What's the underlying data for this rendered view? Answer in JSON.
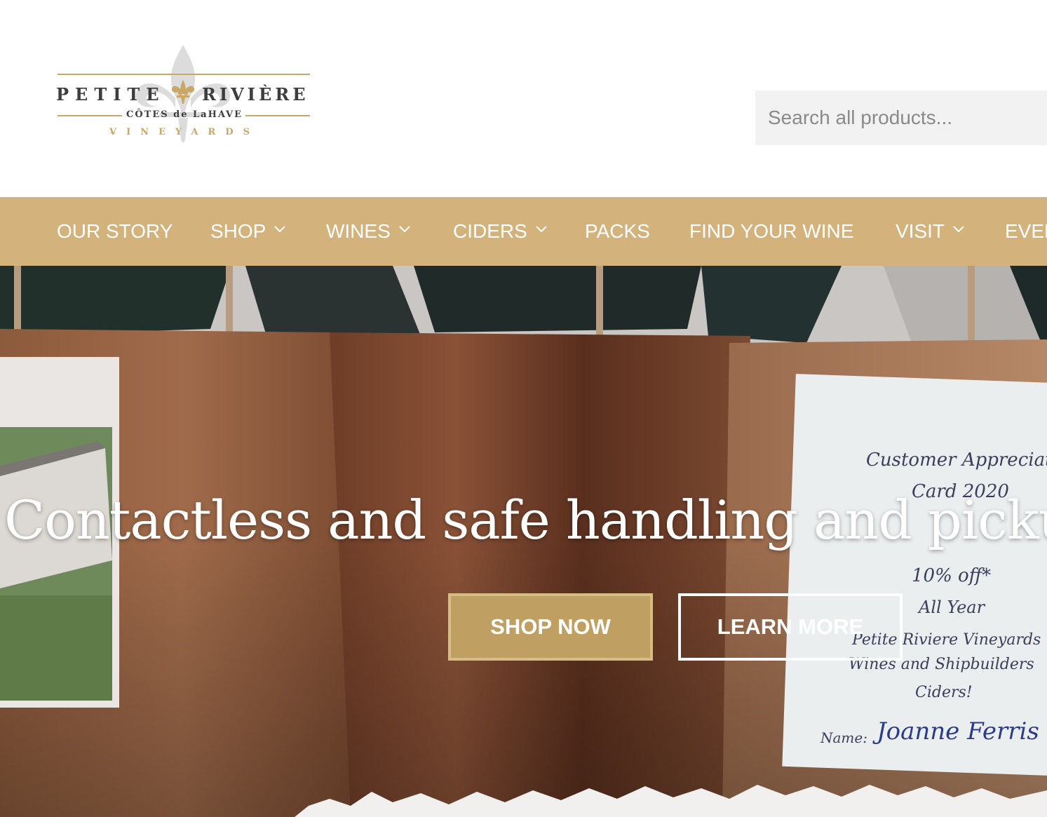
{
  "header": {
    "logo": {
      "name_left": "PETITE",
      "name_right": "RIVIÈRE",
      "subtitle": "CÔTES de LaHAVE",
      "tagline": "VINEYARDS"
    },
    "search": {
      "placeholder": "Search all products..."
    }
  },
  "nav": {
    "items": [
      {
        "label": "OUR STORY",
        "has_dropdown": false
      },
      {
        "label": "SHOP",
        "has_dropdown": true
      },
      {
        "label": "WINES",
        "has_dropdown": true
      },
      {
        "label": "CIDERS",
        "has_dropdown": true
      },
      {
        "label": "PACKS",
        "has_dropdown": false
      },
      {
        "label": "FIND YOUR WINE",
        "has_dropdown": false
      },
      {
        "label": "VISIT",
        "has_dropdown": true
      },
      {
        "label": "EVENTS",
        "has_dropdown": false
      }
    ]
  },
  "hero": {
    "title": "Contactless and safe handling and pickup",
    "primary_button": "SHOP NOW",
    "secondary_button": "LEARN MORE",
    "card_text": {
      "line1": "Customer Appreciation",
      "line2": "Card 2020",
      "line3": "10% off*",
      "line4": "All Year",
      "line5": "Petite Riviere Vineyards",
      "line6": "Wines and Shipbuilders",
      "line7": "Ciders!",
      "name_label": "Name:",
      "name_value": "Joanne Ferris"
    }
  },
  "colors": {
    "nav_bg": "#d3b27b",
    "gold": "#c9a867",
    "button_gold": "#c09f63",
    "search_bg": "#f2f2f2"
  }
}
